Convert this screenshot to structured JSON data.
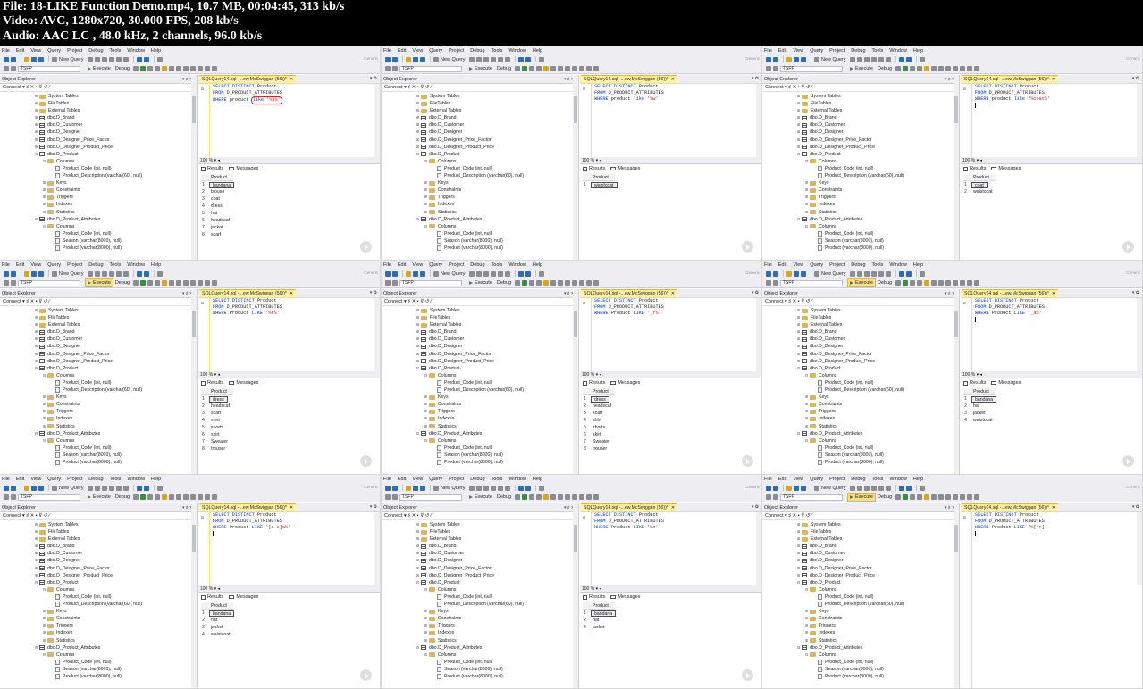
{
  "header": {
    "file": "File: 18-LIKE Function Demo.mp4, 10.7 MB, 00:04:45, 313 kb/s",
    "video": "Video: AVC, 1280x720, 30.000 FPS, 208 kb/s",
    "audio": "Audio: AAC LC , 48.0 kHz, 2 channels, 96.0 kb/s"
  },
  "menu": [
    "File",
    "Edit",
    "View",
    "Query",
    "Project",
    "Debug",
    "Tools",
    "Window",
    "Help"
  ],
  "toolbar": {
    "new_query": "New Query",
    "database": "TSFP",
    "execute": "Execute",
    "debug": "Debug",
    "generic": "Generic"
  },
  "object_explorer": {
    "title": "Object Explorer",
    "pin": "▾ ♯ ✕",
    "connect": "Connect ▾  ♯ ✕ ▪ ⊽ ↺ ⁄"
  },
  "tree_items": [
    {
      "label": "System Tables",
      "level": 0,
      "icon": "folder"
    },
    {
      "label": "FileTables",
      "level": 0,
      "icon": "folder"
    },
    {
      "label": "External Tables",
      "level": 0,
      "icon": "folder"
    },
    {
      "label": "dbo.D_Brand",
      "level": 0,
      "icon": "table"
    },
    {
      "label": "dbo.D_Customer",
      "level": 0,
      "icon": "table"
    },
    {
      "label": "dbo.D_Designer",
      "level": 0,
      "icon": "table"
    },
    {
      "label": "dbo.D_Designer_Price_Factor",
      "level": 0,
      "icon": "table"
    },
    {
      "label": "dbo.D_Designer_Product_Price",
      "level": 0,
      "icon": "table"
    },
    {
      "label": "dbo.D_Product",
      "level": 0,
      "icon": "table",
      "expanded": true
    },
    {
      "label": "Columns",
      "level": 1,
      "icon": "folder",
      "expanded": true
    },
    {
      "label": "Product_Code (int, null)",
      "level": 2,
      "icon": "column"
    },
    {
      "label": "Product_Description (varchar(60), null)",
      "level": 2,
      "icon": "column"
    },
    {
      "label": "Keys",
      "level": 1,
      "icon": "folder"
    },
    {
      "label": "Constraints",
      "level": 1,
      "icon": "folder"
    },
    {
      "label": "Triggers",
      "level": 1,
      "icon": "folder"
    },
    {
      "label": "Indexes",
      "level": 1,
      "icon": "folder"
    },
    {
      "label": "Statistics",
      "level": 1,
      "icon": "folder"
    },
    {
      "label": "dbo.D_Product_Attributes",
      "level": 0,
      "icon": "table",
      "expanded": true
    },
    {
      "label": "Columns",
      "level": 1,
      "icon": "folder",
      "expanded": true
    },
    {
      "label": "Product_Code (int, null)",
      "level": 2,
      "icon": "column"
    },
    {
      "label": "Season (varchar(8000), null)",
      "level": 2,
      "icon": "column"
    },
    {
      "label": "Product (varchar(8000), null)",
      "level": 2,
      "icon": "column"
    }
  ],
  "editor": {
    "tab_title": "SQLQuery14.sql -...ew.McSwiggan (56))*",
    "tab_close": "✕",
    "tab_right": "▾ ✿",
    "zoom": "100 %",
    "results_tab": "Results",
    "messages_tab": "Messages",
    "results_header": "Product"
  },
  "frames": [
    {
      "sql": [
        "SELECT DISTINCT Product",
        "FROM D_PRODUCT_ATTRIBUTES",
        "WHERE product like '%a%'"
      ],
      "line3": {
        "pre": "WHERE ",
        "col": "product ",
        "kw": "like ",
        "str": "'%a%'",
        "circled": true
      },
      "results": [
        "bandana",
        "blouse",
        "coat",
        "dress",
        "hat",
        "headscaf",
        "jacket",
        "scarf"
      ],
      "exec_hl": false
    },
    {
      "sql": [],
      "line3": {
        "pre": "WHERE ",
        "col": "product ",
        "kw": "like ",
        "str": "'%w'",
        "circled": false
      },
      "results": [
        "waistcoat"
      ],
      "exec_hl": false
    },
    {
      "sql": [],
      "line3": {
        "pre": "WHERE ",
        "col": "product ",
        "kw": "like ",
        "str": "'%coat%'",
        "circled": false
      },
      "results": [
        "coat",
        "waistcoat"
      ],
      "exec_hl": false,
      "cursor": true
    },
    {
      "sql": [],
      "line3": {
        "pre": "WHERE ",
        "col": "Product ",
        "kw": "LIKE ",
        "str": "'%r%'",
        "circled": false
      },
      "results": [
        "dress",
        "headscaf",
        "scarf",
        "shirt",
        "shorts",
        "skirt",
        "Sweater",
        "trouser"
      ],
      "exec_hl": true
    },
    {
      "sql": [],
      "line3": {
        "pre": "WHERE ",
        "col": "Product ",
        "kw": "LIKE ",
        "str": "'_r%'",
        "circled": false
      },
      "results": [
        "dress",
        "headscaf",
        "scarf",
        "shirt",
        "shorts",
        "skirt",
        "Sweater",
        "trouser"
      ],
      "exec_hl": false
    },
    {
      "sql": [],
      "line3": {
        "pre": "WHERE ",
        "col": "Product ",
        "kw": "LIKE ",
        "str": "'_a%'",
        "circled": false
      },
      "results": [
        "bandana",
        "hat",
        "jacket",
        "waistcoat"
      ],
      "exec_hl": true,
      "cursor": true
    },
    {
      "sql": [],
      "line3": {
        "pre": "WHERE ",
        "col": "Product ",
        "kw": "LIKE ",
        "str": "'[a-c]a%'",
        "circled": false
      },
      "results": [
        "bandana",
        "hat",
        "jacket",
        "waistcoat"
      ],
      "exec_hl": false,
      "cursor": true
    },
    {
      "sql": [],
      "line3": {
        "pre": "WHERE ",
        "col": "Product ",
        "kw": "LIKE ",
        "str": "'%n'",
        "circled": false
      },
      "results": [
        "bandana",
        "hat",
        "jacket"
      ],
      "exec_hl": false
    },
    {
      "sql": [],
      "line3": {
        "pre": "WHERE ",
        "col": "Product ",
        "kw": "LIKE ",
        "str": "'%[^r]'",
        "circled": false
      },
      "results": [],
      "exec_hl": true,
      "cursor": true
    }
  ],
  "sql_common": {
    "l1_kw": "SELECT DISTINCT ",
    "l1_rest": "Product",
    "l2_kw": "FROM ",
    "l2_rest": "D_PRODUCT_ATTRIBUTES"
  },
  "colors": {
    "accent": "#ffdd5c",
    "keyword": "#0033cc",
    "string": "#c21a1a"
  }
}
